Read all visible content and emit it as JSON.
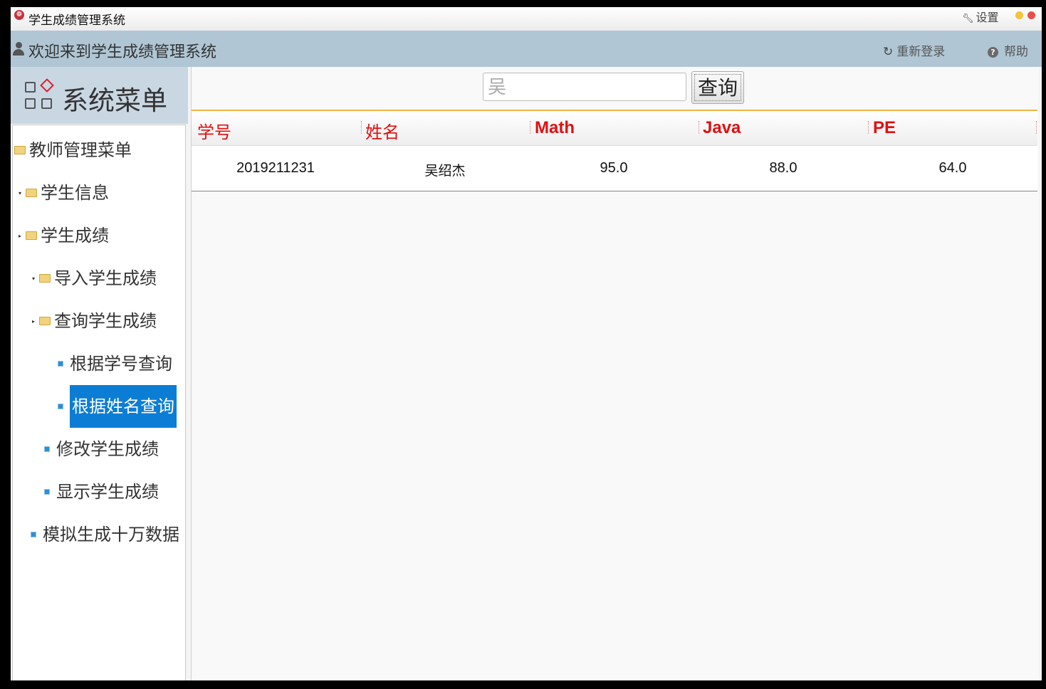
{
  "window": {
    "title": "学生成绩管理系统",
    "settings_label": "设置"
  },
  "header": {
    "welcome": "欢迎来到学生成绩管理系统",
    "relogin_label": "重新登录",
    "help_label": "帮助"
  },
  "sidebar": {
    "title": "系统菜单",
    "items": [
      {
        "label": "教师管理菜单"
      },
      {
        "label": "学生信息"
      },
      {
        "label": "学生成绩"
      },
      {
        "label": "导入学生成绩"
      },
      {
        "label": "查询学生成绩"
      },
      {
        "label": "根据学号查询"
      },
      {
        "label": "根据姓名查询",
        "selected": true
      },
      {
        "label": "修改学生成绩"
      },
      {
        "label": "显示学生成绩"
      },
      {
        "label": "模拟生成十万数据"
      }
    ]
  },
  "search": {
    "value": "吴",
    "button_label": "查询"
  },
  "table": {
    "headers": [
      "学号",
      "姓名",
      "Math",
      "Java",
      "PE"
    ],
    "rows": [
      [
        "2019211231",
        "吴绍杰",
        "95.0",
        "88.0",
        "64.0"
      ]
    ]
  },
  "colors": {
    "header_bg": "#b0c6d4",
    "selected_bg": "#0c7dd4",
    "column_header_text": "#e01010",
    "table_top_border": "#f0b44a"
  },
  "icons": [
    "app-icon",
    "wrench-icon",
    "minimize-icon",
    "close-icon",
    "user-icon",
    "refresh-icon",
    "help-icon",
    "menu-grid-icon",
    "folder-icon",
    "leaf-icon",
    "expand-arrow-icon",
    "collapse-arrow-icon"
  ]
}
